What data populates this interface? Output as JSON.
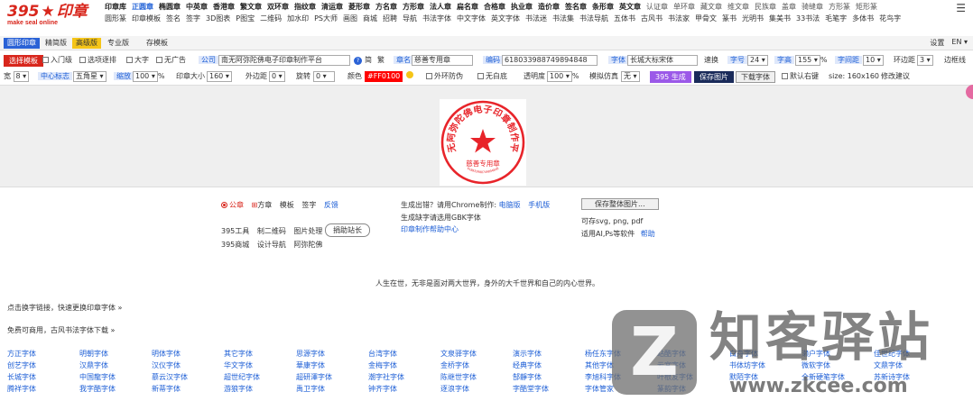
{
  "header": {
    "logo_text": "395",
    "logo_suffix": "印章",
    "logo_sub": "make seal online",
    "nav_row1": [
      "印章库",
      "正圆章",
      "椭圆章",
      "中英章",
      "香港章",
      "繁文章",
      "双环章",
      "指纹章",
      "清运章",
      "菱形章",
      "方名章",
      "方形章",
      "法人章",
      "扁名章",
      "合格章",
      "执业章",
      "造价章",
      "签名章",
      "条形章",
      "英文章",
      "认证章",
      "单环章",
      "藏文章",
      "维文章",
      "民族章",
      "盖章",
      "骑缝章",
      "方形篆",
      "矩形篆"
    ],
    "nav_row2": [
      "圆形篆",
      "印章模板",
      "签名",
      "签字",
      "3D图表",
      "P图宝",
      "二维码",
      "加水印",
      "PS大师",
      "画图",
      "商城",
      "招聘",
      "导航",
      "书法字体",
      "中文字体",
      "英文字体",
      "书法迷",
      "书法集",
      "书法导航",
      "五体书",
      "古风书",
      "书法家",
      "甲骨文",
      "篆书",
      "光明书",
      "集美书",
      "33书法",
      "毛笔字",
      "多体书",
      "花鸟字"
    ]
  },
  "tabs": [
    "圆形印章",
    "精简版",
    "高级版",
    "专业版",
    "存模板"
  ],
  "tabs_right": {
    "settings": "设置",
    "lang": "EN ▾"
  },
  "row1": {
    "select_template": "选择模板",
    "chk_entry": "入门级",
    "chk_option": "选项逐排",
    "chk_big": "大字",
    "chk_noad": "无广告",
    "company_label": "公司",
    "company_value": "南无阿弥陀佛电子印章制作平台",
    "simp": "简",
    "trad": "繁",
    "name_label": "章名",
    "name_value": "慈善专用章",
    "code_label": "编码",
    "code_value": "618033988749894848",
    "font_label": "字体",
    "font_value": "长城大标宋体",
    "speed": "速换",
    "size_label": "字号",
    "size_value": "24",
    "height_label": "字高",
    "height_value": "155",
    "pct": "%",
    "spacing_label": "字间距",
    "spacing_value": "10",
    "ring_label": "环边距",
    "ring_value": "3",
    "border_line": "边框线"
  },
  "row2": {
    "width_label": "宽",
    "width_value": "8",
    "center_label": "中心标志",
    "center_value": "五角星",
    "scale_label": "缩放",
    "scale_value": "100",
    "pct": "%",
    "seal_size_label": "印章大小",
    "seal_size_value": "160",
    "outer_label": "外边距",
    "outer_value": "0",
    "rotate_label": "旋转",
    "rotate_value": "0",
    "color_label": "颜色",
    "color_value": "#FF0100",
    "chk_anti": "外环防伪",
    "chk_white": "无白底",
    "opacity_label": "透明度",
    "opacity_value": "100",
    "pct2": "%",
    "emulate_label": "模拟仿真",
    "emulate_value": "无",
    "btn_generate": "395 生成",
    "btn_save": "保存图片",
    "btn_download": "下载字体",
    "chk_rightkey": "默认右键",
    "size_info": "size: 160x160",
    "suggest": "修改建议"
  },
  "seal": {
    "color": "#e8242a",
    "ring_text": "南无阿弥陀佛电子印章制作平台",
    "bottom_text": "慈善专用章",
    "code_text": "618033988749894848"
  },
  "footer": {
    "radio_gz": "公章",
    "fz": "方章",
    "mb": "模板",
    "qz": "签字",
    "fk": "反馈",
    "tools": [
      "395工具",
      "制二维码",
      "图片处理"
    ],
    "donate": "捐助站长",
    "links2": [
      "395商城",
      "设计导航",
      "阿弥陀佛"
    ],
    "err_line": "生成出错？请用Chrome制作:",
    "pc": "电脑版",
    "mobile": "手机版",
    "gbk_line": "生成缺字请选用GBK字体",
    "help_center": "印章制作帮助中心",
    "save_all": "保存整体图片...",
    "save_fmt": "可存svg, png, pdf",
    "ai_line": "适用AI,Ps等软件",
    "help": "帮助",
    "quote": "人生在世，无非是面对两大世界，身外的大千世界和自己的内心世界。",
    "change_font": "点击换字链接，快速更换印章字体 »",
    "free_fonts": "免费可商用，古风书法字体下载 »"
  },
  "fonts": [
    [
      "方正字体",
      "明朝字体",
      "明体字体",
      "其它字体",
      "思源字体",
      "台湾字体",
      "文泉驿字体",
      "演示字体",
      "杨任东字体",
      "站酷字体",
      "白舟字体",
      "濑户字体",
      "佳世纪字体"
    ],
    [
      "创艺字体",
      "汉鼎字体",
      "汉仪字体",
      "华文字体",
      "華康字体",
      "金梅字体",
      "金桥字体",
      "经典字体",
      "其他字体",
      "云宮字体",
      "书体坊字体",
      "微软字体",
      "文鼎字体"
    ],
    [
      "长城字体",
      "中国龍字体",
      "慕云汉字体",
      "超世纪字体",
      "超研澤字体",
      "潮字社字体",
      "陈继世字体",
      "郜靜字体",
      "李旭科字体",
      "叶根友字体",
      "默陌字体",
      "全新硬笔字体",
      "苏新诗字体"
    ],
    [
      "腾祥字体",
      "我字酷字体",
      "新蒂字体",
      "游狼字体",
      "禹卫字体",
      "钟齐字体",
      "逐浪字体",
      "字酷堂字体",
      "字体管家",
      "篆韵字体"
    ]
  ],
  "watermark": {
    "mark": "Z",
    "title": "知客驿站",
    "url": "www.zkcee.com"
  }
}
